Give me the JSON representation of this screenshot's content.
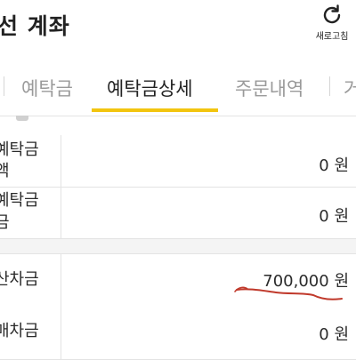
{
  "header": {
    "title": "선 계좌",
    "refresh_label": "새로고침",
    "refresh_icon": "refresh-icon"
  },
  "tabs": [
    {
      "label": "예탁금",
      "active": false
    },
    {
      "label": "예탁금상세",
      "active": true
    },
    {
      "label": "주문내역",
      "active": false
    },
    {
      "label": "거",
      "active": false
    }
  ],
  "rows": [
    {
      "label_line1": "예탁금",
      "label_line2": "액",
      "value": "0 원"
    },
    {
      "label_line1": "예탁금",
      "label_line2": "금",
      "value": "0 원"
    },
    {
      "label_line1": "산차금",
      "value": "700,000 원"
    },
    {
      "label_line1": "매차금",
      "value": "0 원"
    }
  ],
  "colors": {
    "accent": "#f2c50f",
    "handwritten_mark": "#c0392b"
  }
}
